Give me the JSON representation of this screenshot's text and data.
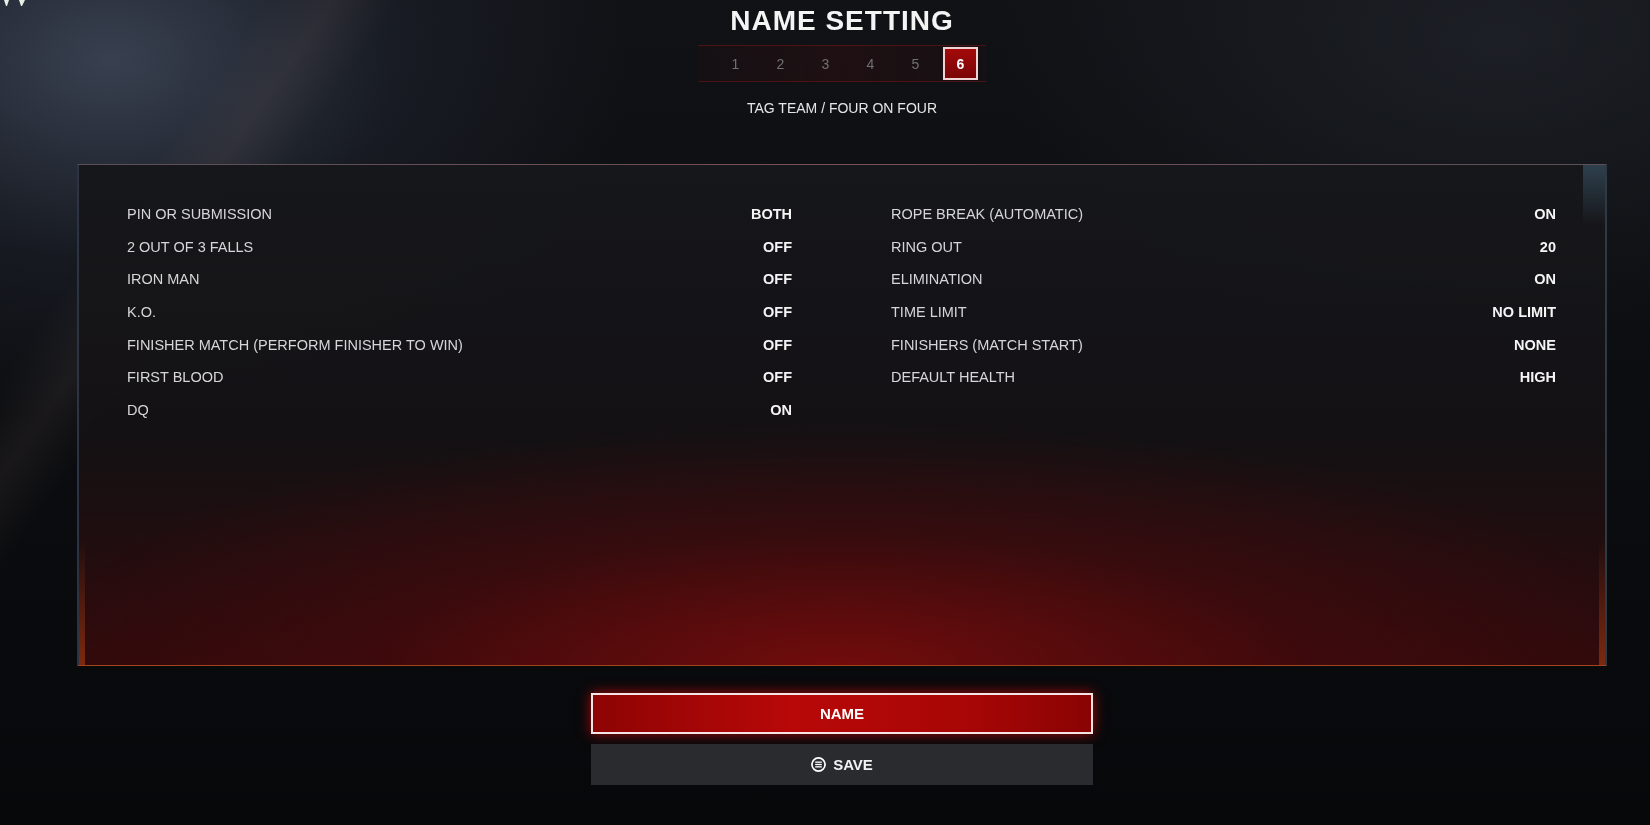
{
  "header": {
    "title": "NAME SETTING",
    "steps": [
      {
        "label": "1",
        "selected": false
      },
      {
        "label": "2",
        "selected": false
      },
      {
        "label": "3",
        "selected": false
      },
      {
        "label": "4",
        "selected": false
      },
      {
        "label": "5",
        "selected": false
      },
      {
        "label": "6",
        "selected": true
      }
    ],
    "subtitle": "TAG TEAM / FOUR ON FOUR"
  },
  "settings": {
    "columns": [
      {
        "rows": [
          {
            "label": "PIN OR SUBMISSION",
            "value": "BOTH"
          },
          {
            "label": "2 OUT OF 3 FALLS",
            "value": "OFF"
          },
          {
            "label": "IRON MAN",
            "value": "OFF"
          },
          {
            "label": "K.O.",
            "value": "OFF"
          },
          {
            "label": "FINISHER MATCH (PERFORM FINISHER TO WIN)",
            "value": "OFF"
          },
          {
            "label": "FIRST BLOOD",
            "value": "OFF"
          },
          {
            "label": "DQ",
            "value": "ON"
          }
        ]
      },
      {
        "rows": [
          {
            "label": "ROPE BREAK (AUTOMATIC)",
            "value": "ON"
          },
          {
            "label": "RING OUT",
            "value": "20"
          },
          {
            "label": "ELIMINATION",
            "value": "ON"
          },
          {
            "label": "TIME LIMIT",
            "value": "NO LIMIT"
          },
          {
            "label": "FINISHERS (MATCH START)",
            "value": "NONE"
          },
          {
            "label": "DEFAULT HEALTH",
            "value": "HIGH"
          }
        ]
      }
    ]
  },
  "buttons": [
    {
      "label": "NAME",
      "selected": true,
      "kind": "text"
    },
    {
      "label": "SAVE",
      "selected": false,
      "kind": "key_hint"
    }
  ]
}
